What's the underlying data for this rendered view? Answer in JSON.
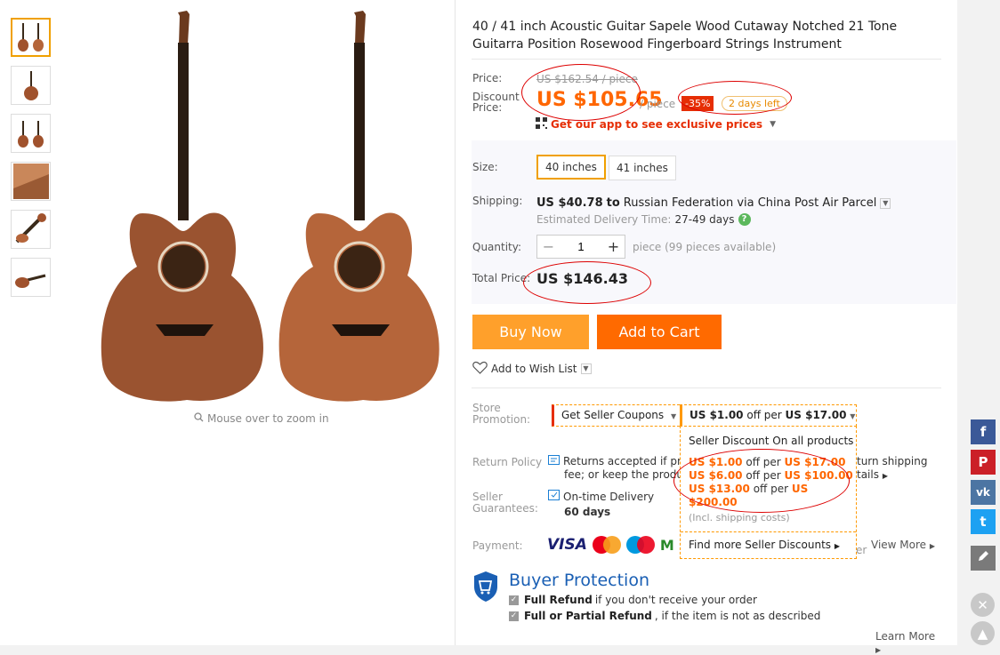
{
  "product": {
    "title": "40 / 41 inch Acoustic Guitar Sapele Wood Cutaway Notched 21 Tone Guitarra Position Rosewood Fingerboard Strings Instrument"
  },
  "gallery": {
    "thumbs": [
      "pair-front-thumb",
      "side-thumb",
      "pair-thumb",
      "body-closeup-thumb",
      "headstock-thumb",
      "neck-thumb"
    ],
    "zoom_hint": "Mouse over to zoom in"
  },
  "price": {
    "label": "Price:",
    "original": "US $162.54 / piece",
    "discount_label": "Discount Price:",
    "discount_label_line1": "Discount",
    "discount_label_line2": "Price:",
    "discount": "US $105.65",
    "per_piece": "/ piece",
    "off": "-35%",
    "days_left": "2 days left",
    "app_promo": "Get our app to see exclusive prices"
  },
  "sku": {
    "size_label": "Size:",
    "sizes": [
      "40 inches",
      "41 inches"
    ],
    "selected_size": "40 inches",
    "shipping_label": "Shipping:",
    "shipping_price": "US $40.78",
    "shipping_to": "to",
    "shipping_dest": "Russian Federation via China Post Air Parcel",
    "delivery_label": "Estimated Delivery Time:",
    "delivery_time": "27-49 days",
    "quantity_label": "Quantity:",
    "quantity": "1",
    "minus": "−",
    "plus": "+",
    "qty_note": "piece (99 pieces available)",
    "total_label": "Total Price:",
    "total": "US $146.43"
  },
  "actions": {
    "buy_now": "Buy Now",
    "add_to_cart": "Add to Cart",
    "wishlist": "Add to Wish List"
  },
  "store": {
    "promo_label_1": "Store",
    "promo_label_2": "Promotion:",
    "get_coupons": "Get Seller Coupons",
    "discount_head_amount": "US $1.00",
    "discount_head_mid": "off per",
    "discount_head_threshold": "US $17.00",
    "panel_title": "Seller Discount On all products",
    "tiers": [
      {
        "amount": "US $1.00",
        "mid": "off per",
        "threshold": "US $17.00"
      },
      {
        "amount": "US $6.00",
        "mid": "off per",
        "threshold": "US $100.00"
      },
      {
        "amount": "US $13.00",
        "mid": "off per",
        "threshold_1": "US",
        "threshold_2": "$200.00"
      }
    ],
    "panel_note": "(Incl. shipping costs)",
    "find_more": "Find more Seller Discounts"
  },
  "policy": {
    "return_label": "Return Policy",
    "return_text_a": "Returns accepted if pro",
    "return_text_b": "turn shipping",
    "return_text_c": "fee; or keep the produc",
    "return_text_d": "tails",
    "seller_label_1": "Seller",
    "seller_label_2": "Guarantees:",
    "ontime": "On-time Delivery",
    "ontime_days": "60 days",
    "payment_label": "Payment:",
    "payment_methods": [
      "VISA",
      "MasterCard",
      "Maestro",
      "M"
    ],
    "payment_tail": "er",
    "view_more": "View More"
  },
  "buyer_protection": {
    "title": "Buyer Protection",
    "line1_bold": "Full Refund",
    "line1_rest": "if you don't receive your order",
    "line2_bold": "Full or Partial Refund",
    "line2_rest": ", if the item is not as described",
    "learn_more": "Learn More"
  },
  "share": {
    "facebook": "f",
    "pinterest": "P",
    "vk": "vk",
    "twitter": "t"
  },
  "colors": {
    "orange": "#ff6a00",
    "buy_orange": "#ffa02b",
    "red": "#e62e04",
    "blue_title": "#1a5fb4",
    "facebook": "#3b5998",
    "pinterest": "#cb2027",
    "vk": "#4c75a3",
    "twitter": "#1da1f2"
  }
}
